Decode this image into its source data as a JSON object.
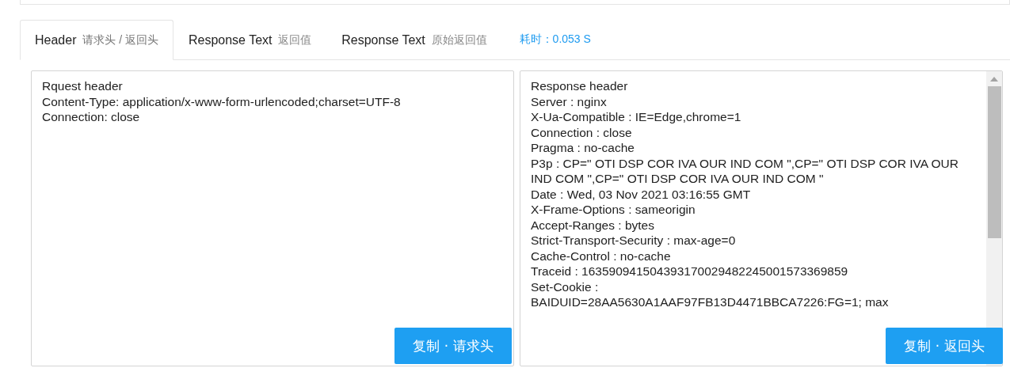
{
  "tabs": [
    {
      "label": "Header",
      "note": "请求头 / 返回头",
      "selected": true
    },
    {
      "label": "Response Text",
      "note": "返回值",
      "selected": false
    },
    {
      "label": "Response Text",
      "note": "原始返回值",
      "selected": false
    }
  ],
  "timing": "耗时：0.053 S",
  "request_panel": {
    "lines": [
      "Rquest header",
      "Content-Type: application/x-www-form-urlencoded;charset=UTF-8",
      "Connection: close"
    ],
    "button": "复制 · 请求头"
  },
  "response_panel": {
    "lines": [
      "Response header",
      "Server : nginx",
      "X-Ua-Compatible : IE=Edge,chrome=1",
      "Connection : close",
      "Pragma : no-cache",
      "P3p : CP=\" OTI DSP COR IVA OUR IND COM \",CP=\" OTI DSP COR IVA OUR IND COM \",CP=\" OTI DSP COR IVA OUR IND COM \"",
      "Date : Wed, 03 Nov 2021 03:16:55 GMT",
      "X-Frame-Options : sameorigin",
      "Accept-Ranges : bytes",
      "Strict-Transport-Security : max-age=0",
      "Cache-Control : no-cache",
      "Traceid : 163590941504393170029482245001573369859",
      "Set-Cookie :",
      "BAIDUID=28AA5630A1AAF97FB13D4471BBCA7226:FG=1; max"
    ],
    "button": "复制 · 返回头"
  }
}
